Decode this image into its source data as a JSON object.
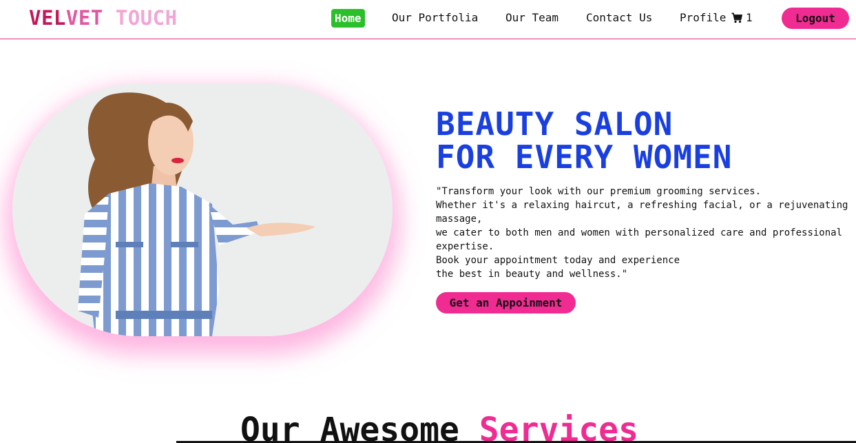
{
  "brand": {
    "part1": "VEL",
    "part2": "VET ",
    "part3": "TOUCH"
  },
  "nav": {
    "home": "Home",
    "portfolio": "Our Portfolia",
    "team": "Our Team",
    "contact": "Contact Us",
    "profile": "Profile",
    "cart_count": "1",
    "logout": "Logout"
  },
  "hero": {
    "title_line1": "BEAUTY SALON",
    "title_line2": "FOR EVERY WOMEN",
    "description_lines": [
      "\"Transform your look with our premium grooming services.",
      "Whether it's a relaxing haircut, a refreshing facial, or a rejuvenating",
      "massage,",
      "we cater to both men and women with personalized care and professional",
      "expertise.",
      "Book your appointment today and experience",
      "the best in beauty and wellness.\""
    ],
    "cta": "Get an Appoinment"
  },
  "services": {
    "heading_part1": "Our Awesome ",
    "heading_part2": "Services"
  },
  "icons": {
    "cart": "shopping-cart-icon",
    "hero_image": "woman-in-striped-shirt-photo"
  },
  "colors": {
    "accent_pink": "#f02b92",
    "home_green": "#2bbf2b",
    "title_blue": "#1a3fe0"
  }
}
